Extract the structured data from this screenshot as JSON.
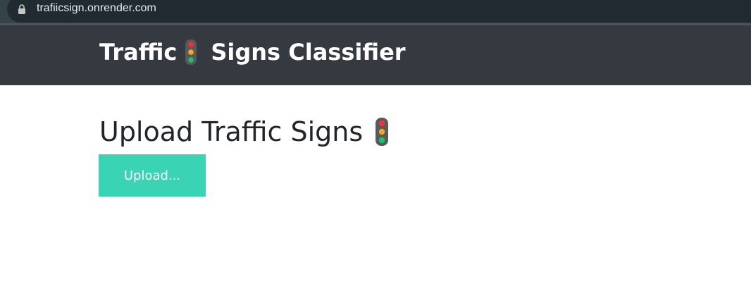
{
  "browser": {
    "url": "trafiicsign.onrender.com"
  },
  "navbar": {
    "brand_before_icon": "Traffic",
    "brand_after_icon": "Signs Classifier",
    "brand_icon": "traffic-light-icon"
  },
  "main": {
    "title": "Upload Traffic Signs",
    "title_icon": "traffic-light-icon",
    "upload_label": "Upload..."
  },
  "colors": {
    "navbar_bg": "#343a40",
    "upload_button_bg": "#3ad3b4",
    "title_text": "#212529"
  }
}
